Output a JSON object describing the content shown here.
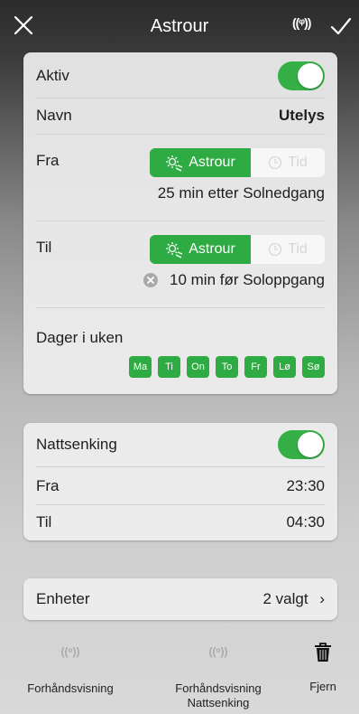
{
  "header": {
    "title": "Astrour",
    "close_icon": "close-icon",
    "broadcast_icon": "broadcast-icon",
    "check_icon": "checkmark-icon",
    "broadcast_glyph": "((ᵠ))"
  },
  "schedule": {
    "active_label": "Aktiv",
    "active_on": true,
    "name_label": "Navn",
    "name_value": "Utelys",
    "from": {
      "label": "Fra",
      "seg_astro": "Astrour",
      "seg_time": "Tid",
      "selected": "Astrour",
      "description": "25 min etter Solnedgang"
    },
    "to": {
      "label": "Til",
      "seg_astro": "Astrour",
      "seg_time": "Tid",
      "selected": "Astrour",
      "description": "10 min før Soloppgang"
    },
    "days_label": "Dager i uken",
    "days": [
      "Ma",
      "Ti",
      "On",
      "To",
      "Fr",
      "Lø",
      "Sø"
    ]
  },
  "night_setback": {
    "label": "Nattsenking",
    "on": true,
    "from_label": "Fra",
    "from_value": "23:30",
    "to_label": "Til",
    "to_value": "04:30"
  },
  "units": {
    "label": "Enheter",
    "value": "2 valgt",
    "chevron": "›"
  },
  "toolbar": {
    "preview_label": "Forhåndsvisning",
    "preview_night_line1": "Forhåndsvisning",
    "preview_night_line2": "Nattsenking",
    "remove_label": "Fjern",
    "preview_glyph": "((ᵒ))"
  },
  "colors": {
    "accent_green": "#2fab43"
  }
}
